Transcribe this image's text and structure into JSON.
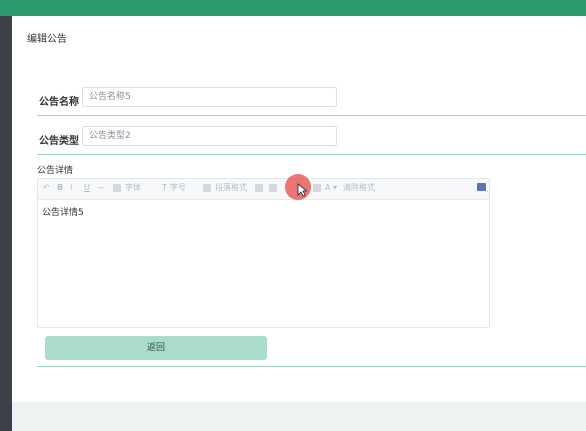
{
  "page": {
    "title": "编辑公告"
  },
  "form": {
    "name": {
      "label": "公告名称",
      "value": "公告名称5"
    },
    "type": {
      "label": "公告类型",
      "value": "公告类型2"
    },
    "detail": {
      "label": "公告详情",
      "content": "公告详情5"
    }
  },
  "toolbar": {
    "font_label": "字体",
    "size_label": "字号",
    "format_label": "段落格式",
    "clear_label": "清除格式"
  },
  "actions": {
    "back_label": "返回"
  },
  "colors": {
    "accent": "#2e9a6e",
    "button": "#a9dccb",
    "sidebar": "#3b4147"
  }
}
